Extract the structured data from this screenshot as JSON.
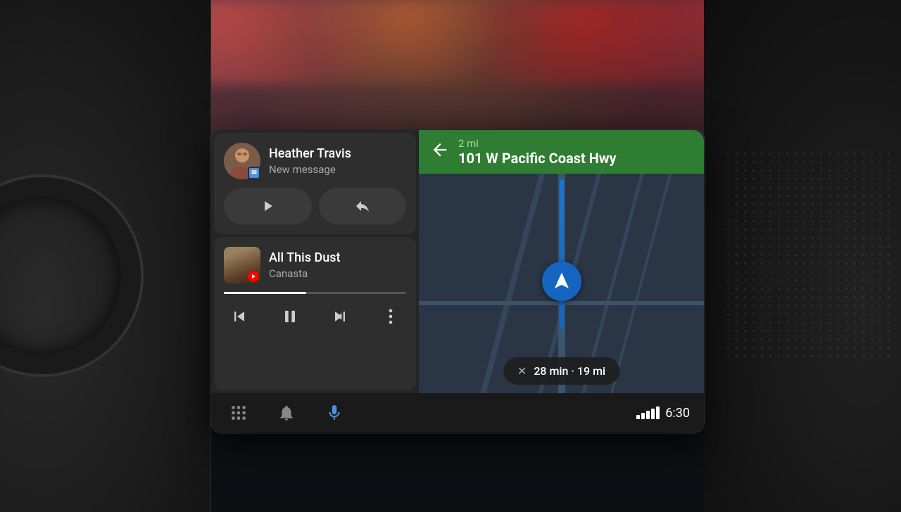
{
  "dashboard": {
    "background_color": "#1a1e28"
  },
  "screen": {
    "message_card": {
      "contact_name": "Heather Travis",
      "message_label": "New message",
      "play_button_label": "Play",
      "reply_button_label": "Reply"
    },
    "music_card": {
      "song_title": "All This Dust",
      "artist_name": "Canasta",
      "progress_percent": 45,
      "controls": {
        "prev_label": "Previous",
        "pause_label": "Pause",
        "next_label": "Next",
        "more_label": "More options"
      }
    },
    "navigation": {
      "direction": "Turn left",
      "distance": "2 mi",
      "street": "101 W Pacific Coast Hwy",
      "eta_time": "28 min",
      "eta_distance": "19 mi"
    },
    "toolbar": {
      "apps_label": "Apps",
      "notifications_label": "Notifications",
      "mic_label": "Voice input",
      "time": "6:30"
    }
  }
}
